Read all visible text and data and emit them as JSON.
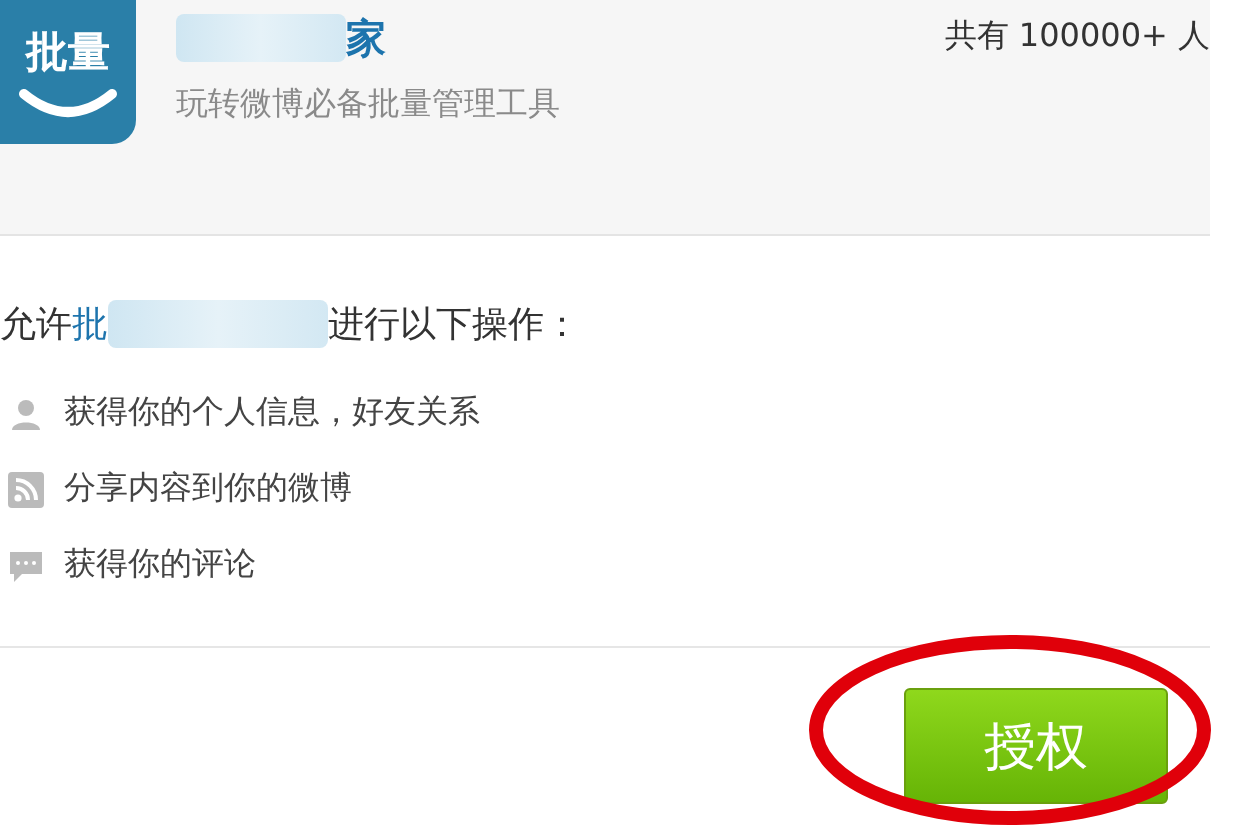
{
  "app": {
    "logo_text": "批量",
    "name_visible": "家",
    "tagline": "玩转微博必备批量管理工具",
    "user_count": "共有 100000+ 人"
  },
  "prompt": {
    "prefix": "允许",
    "app_ref": "批",
    "suffix": "进行以下操作："
  },
  "permissions": [
    {
      "kind": "person",
      "text": "获得你的个人信息，好友关系"
    },
    {
      "kind": "share",
      "text": "分享内容到你的微博"
    },
    {
      "kind": "comment",
      "text": "获得你的评论"
    }
  ],
  "authorize_button": "授权"
}
